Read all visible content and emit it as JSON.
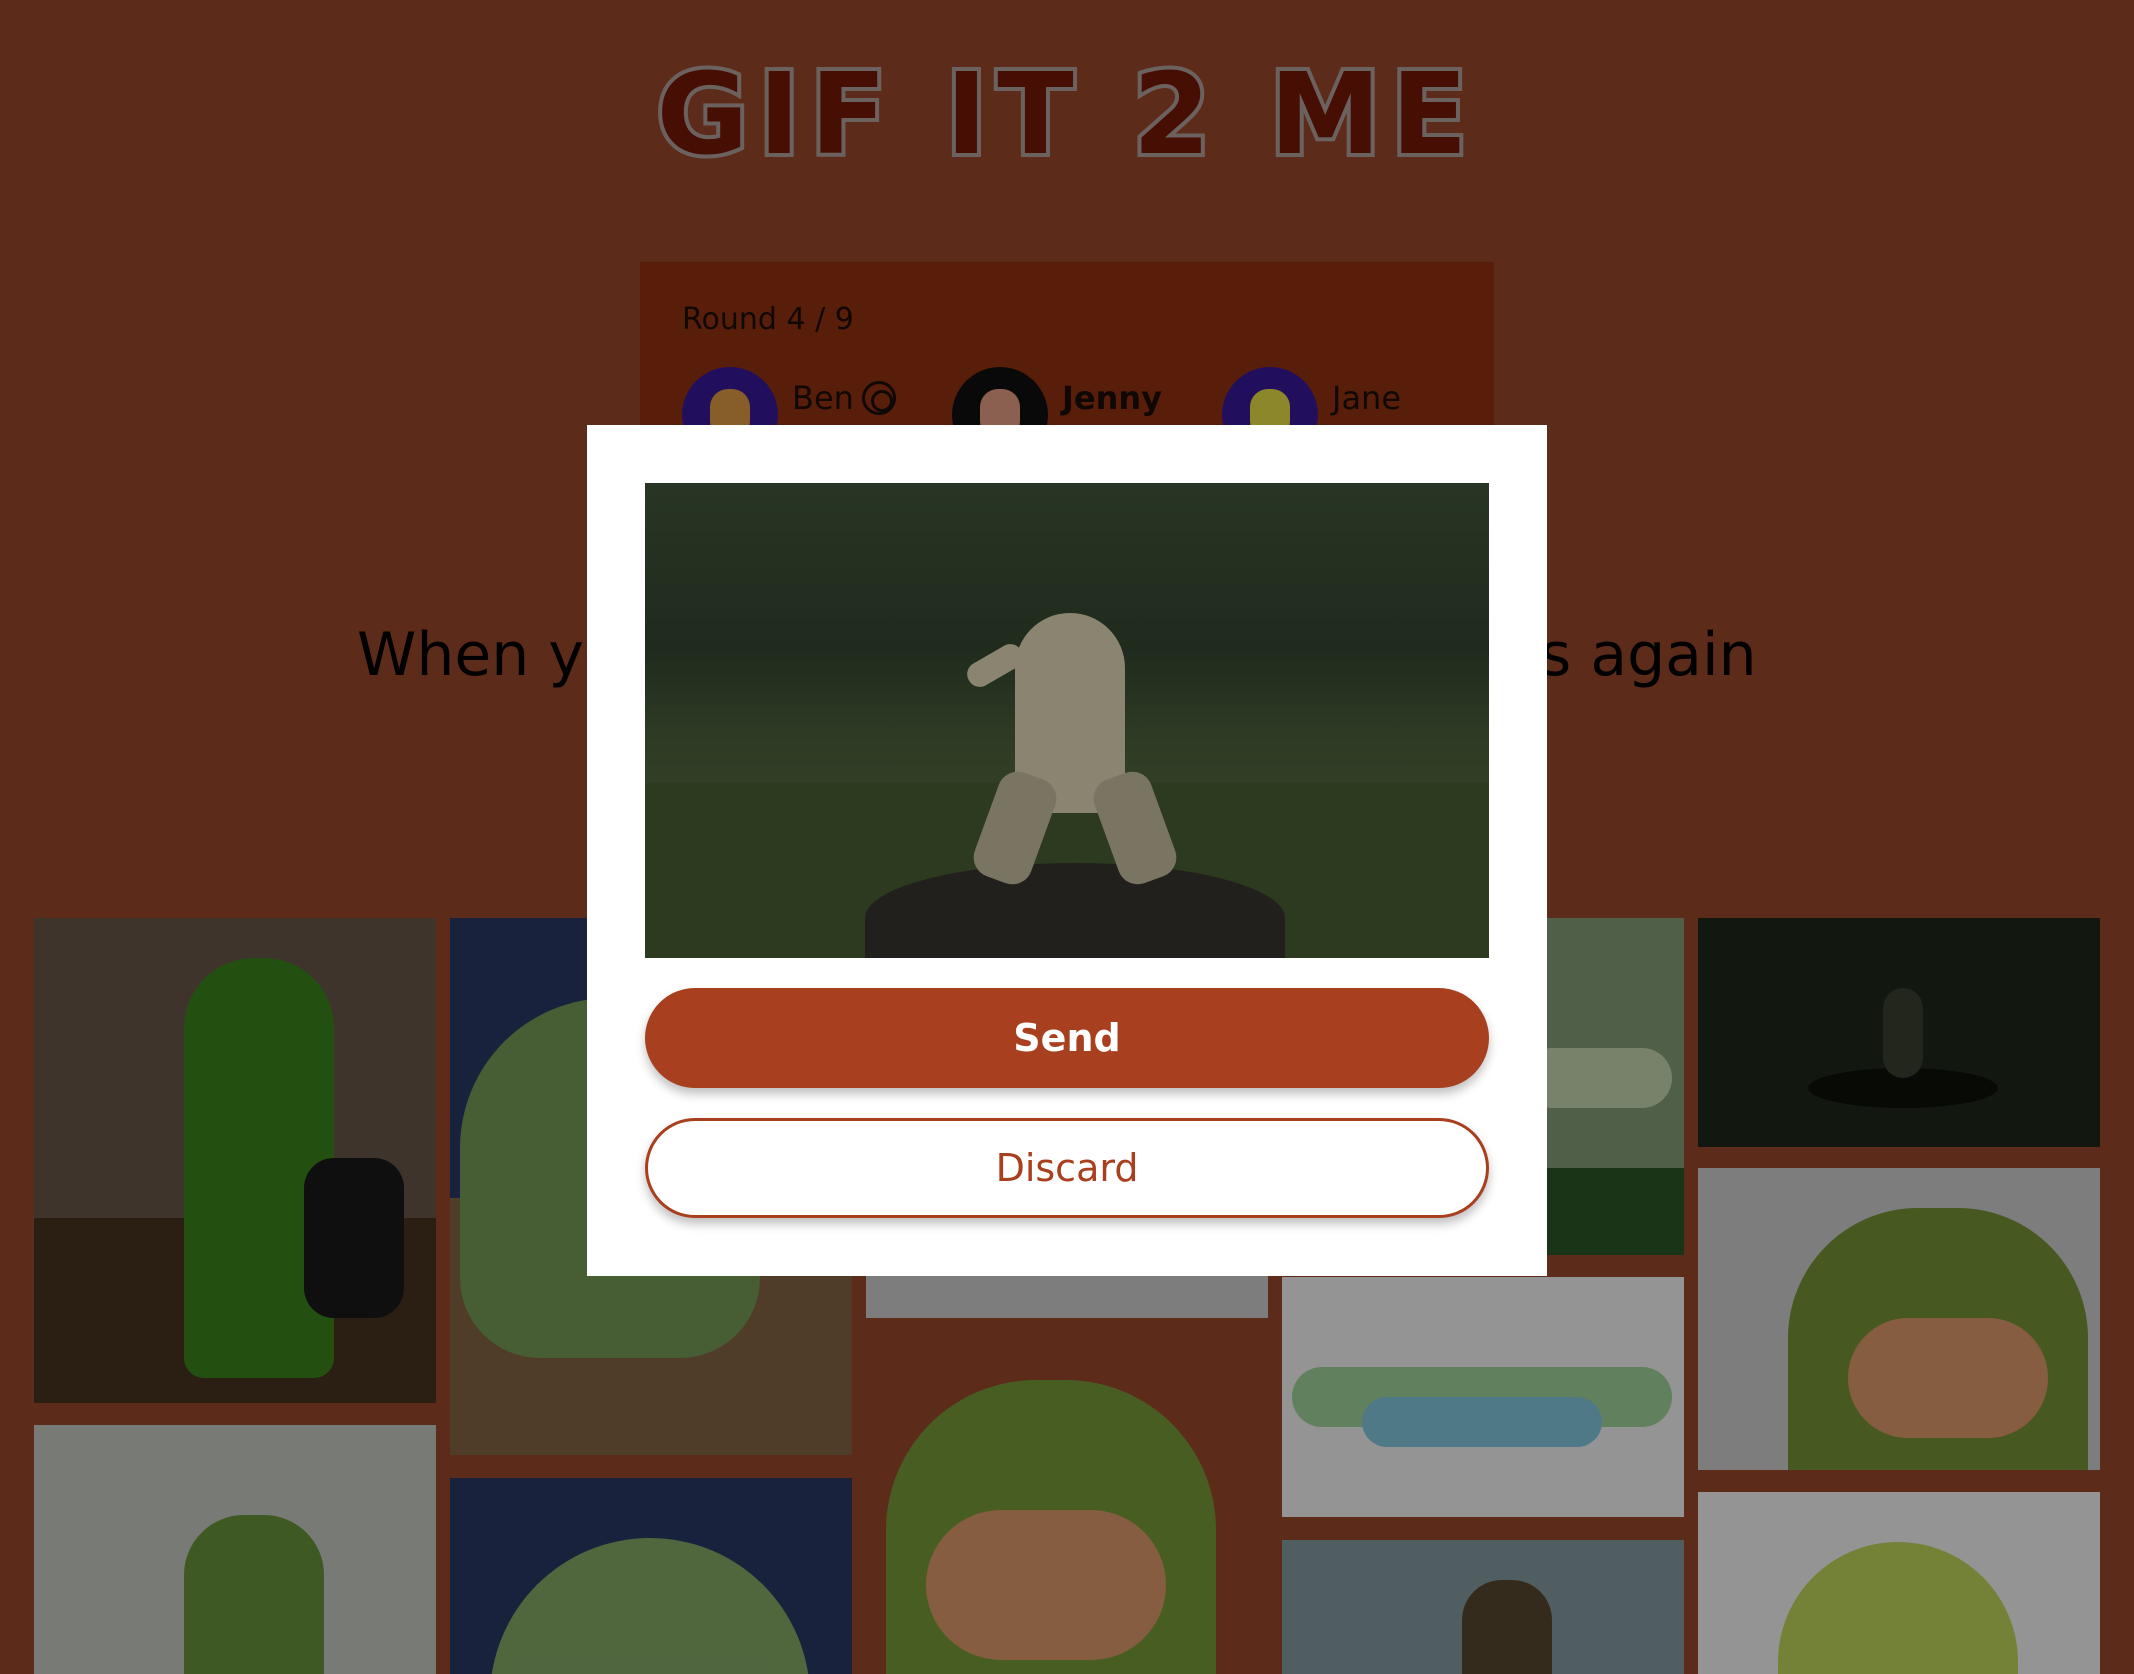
{
  "app": {
    "logo_text": "GIF IT 2 ME"
  },
  "round": {
    "label": "Round 4 / 9"
  },
  "players": [
    {
      "name": "Ben",
      "is_host": true,
      "avatar_bg": "#3a1aa0",
      "avatar_face": "#e8a048",
      "avatar_body": "#d84020"
    },
    {
      "name": "Jenny",
      "is_host": false,
      "avatar_bg": "#111111",
      "avatar_face": "#f0a58a",
      "avatar_body": "#4fd0b8"
    },
    {
      "name": "Jane",
      "is_host": false,
      "avatar_bg": "#3a1aa0",
      "avatar_face": "#f2e94a",
      "avatar_body": "#6c5cf0"
    }
  ],
  "prompt": {
    "visible_left": "When yo",
    "visible_right": "s again"
  },
  "modal": {
    "send_label": "Send",
    "discard_label": "Discard"
  },
  "colors": {
    "page_bg": "#a14a2c",
    "panel_bg": "#9a3410",
    "accent": "#a83f1e"
  }
}
